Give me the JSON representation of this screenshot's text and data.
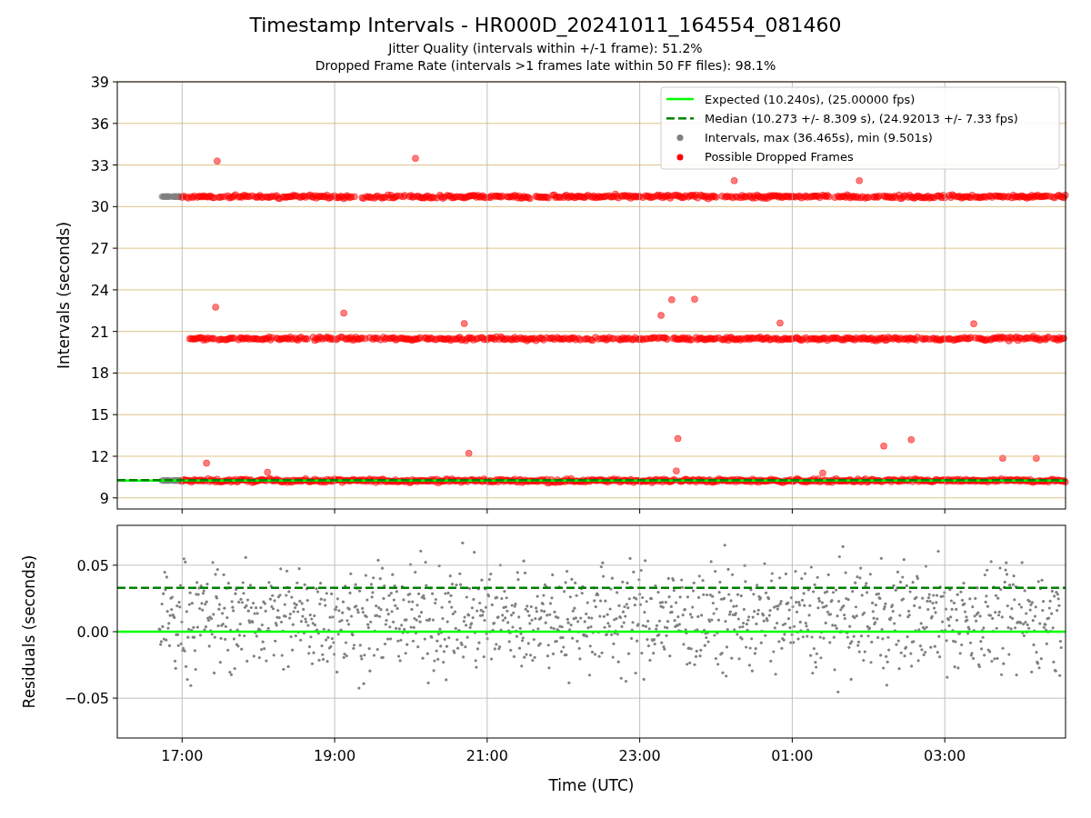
{
  "title": "Timestamp Intervals - HR000D_20241011_164554_081460",
  "subtitles": [
    "Jitter Quality (intervals within +/-1 frame): 51.2%",
    "Dropped Frame Rate (intervals >1 frames late within 50 FF files): 98.1%"
  ],
  "intervals_chart": {
    "chart_data": {
      "type": "scatter",
      "ylabel": "Intervals (seconds)",
      "grid": true,
      "x": [
        "2024-10-11T16:09",
        "2024-10-12T04:35"
      ],
      "xlim": [
        "2024-10-11T16:09",
        "2024-10-12T04:35"
      ],
      "ylim": [
        8.2,
        39
      ],
      "yticks": [
        9,
        12,
        15,
        18,
        21,
        24,
        27,
        30,
        33,
        36,
        39
      ],
      "legend": true,
      "series": [
        {
          "name": "Expected (10.240s), (25.00000 fps)",
          "type": "line",
          "line_style": "solid",
          "color": "#00ff00",
          "values": [
            10.24,
            10.24
          ]
        },
        {
          "name": "Median (10.273 +/- 8.309 s), (24.92013 +/- 7.33 fps)",
          "type": "line",
          "line_style": "dashed",
          "color": "#008000",
          "values": [
            10.273,
            10.273
          ]
        }
      ]
    }
  },
  "point_legend": [
    {
      "label": "Intervals, max (36.465s), min (9.501s)",
      "color": "#808080"
    },
    {
      "label": "Possible Dropped Frames",
      "color": "#ff0000"
    }
  ],
  "residuals_chart": {
    "chart_data": {
      "type": "scatter",
      "xlabel": "Time (UTC)",
      "ylabel": "Residuals (seconds)",
      "grid": true,
      "x": [
        "2024-10-11T16:09",
        "2024-10-12T04:35"
      ],
      "xlim": [
        "2024-10-11T16:09",
        "2024-10-12T04:35"
      ],
      "ylim": [
        -0.08,
        0.08
      ],
      "xticks": [
        {
          "value": "2024-10-11T17:00",
          "label": "17:00"
        },
        {
          "value": "2024-10-11T19:00",
          "label": "19:00"
        },
        {
          "value": "2024-10-11T21:00",
          "label": "21:00"
        },
        {
          "value": "2024-10-11T23:00",
          "label": "23:00"
        },
        {
          "value": "2024-10-12T01:00",
          "label": "01:00"
        },
        {
          "value": "2024-10-12T03:00",
          "label": "03:00"
        }
      ],
      "yticks": [
        {
          "value": 0.05,
          "label": "0.05"
        },
        {
          "value": 0,
          "label": "0.00"
        },
        {
          "value": -0.05,
          "label": "−0.05"
        }
      ],
      "series": [
        {
          "type": "line",
          "line_style": "solid",
          "color": "#00ff00",
          "values": [
            0,
            0
          ]
        },
        {
          "type": "line",
          "line_style": "dashed",
          "color": "#008000",
          "values": [
            0.033,
            0.033
          ]
        }
      ]
    }
  }
}
